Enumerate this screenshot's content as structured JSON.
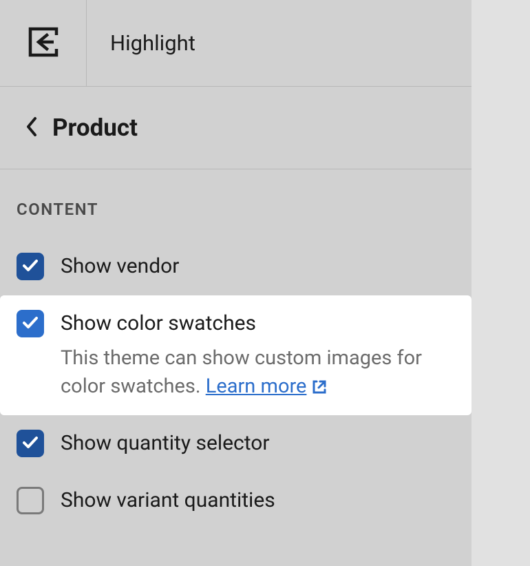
{
  "topbar": {
    "title": "Highlight",
    "back_icon": "back-to-editor-icon"
  },
  "breadcrumb": {
    "title": "Product",
    "chevron_icon": "chevron-left-icon"
  },
  "section": {
    "label": "CONTENT"
  },
  "options": [
    {
      "id": "show-vendor",
      "label": "Show vendor",
      "checked": true,
      "highlighted": false
    },
    {
      "id": "show-color-swatches",
      "label": "Show color swatches",
      "desc_prefix": "This theme can show custom images for color swatches. ",
      "learn_more": "Learn more",
      "checked": true,
      "highlighted": true
    },
    {
      "id": "show-quantity-selector",
      "label": "Show quantity selector",
      "checked": true,
      "highlighted": false
    },
    {
      "id": "show-variant-quantities",
      "label": "Show variant quantities",
      "checked": false,
      "highlighted": false
    }
  ],
  "colors": {
    "checkbox_dark": "#1f5199",
    "checkbox_bright": "#2c6ecb",
    "link": "#2c6ecb"
  }
}
